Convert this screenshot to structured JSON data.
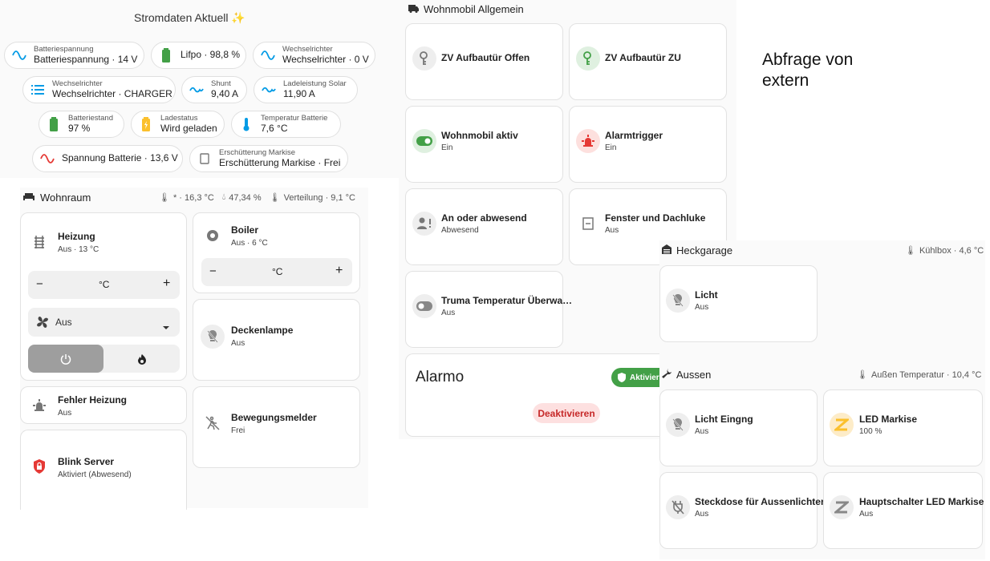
{
  "strom": {
    "title": "Stromdaten Aktuell",
    "sparkle": "✨",
    "chips": [
      {
        "small": "Batteriespannung",
        "big": "Batteriespannung · 14 V"
      },
      {
        "small": "",
        "big": "Lifpo · 98,8 %"
      },
      {
        "small": "Wechselrichter",
        "big": "Wechselrichter · 0 V"
      },
      {
        "small": "Wechselrichter",
        "big": "Wechselrichter · CHARGER"
      },
      {
        "small": "Shunt",
        "big": "9,40 A"
      },
      {
        "small": "Ladeleistung Solar",
        "big": "11,90 A"
      },
      {
        "small": "Batteriestand",
        "big": "97 %"
      },
      {
        "small": "Ladestatus",
        "big": "Wird geladen"
      },
      {
        "small": "Temperatur Batterie",
        "big": "7,6 °C"
      },
      {
        "small": "",
        "big": "Spannung Batterie · 13,6 V"
      },
      {
        "small": "Erschütterung Markise",
        "big": "Erschütterung Markise · Frei"
      }
    ]
  },
  "wohnraum": {
    "title": "Wohnraum",
    "meta1": "* · 16,3 °C",
    "meta2": "47,34 %",
    "meta3": "Verteilung · 9,1 °C",
    "heizung": {
      "title": "Heizung",
      "state": "Aus · 13 °C",
      "unit": "°C",
      "minus": "−",
      "plus": "+",
      "mode": "Aus"
    },
    "boiler": {
      "title": "Boiler",
      "state": "Aus · 6 °C",
      "unit": "°C",
      "minus": "−",
      "plus": "+"
    },
    "deckenlampe": {
      "title": "Deckenlampe",
      "state": "Aus"
    },
    "fehler": {
      "title": "Fehler Heizung",
      "state": "Aus"
    },
    "bewegung": {
      "title": "Bewegungsmelder",
      "state": "Frei"
    },
    "blink": {
      "title": "Blink Server",
      "state": "Aktiviert (Abwesend)"
    }
  },
  "wohnmobil": {
    "title": "Wohnmobil Allgemein",
    "tiles": [
      {
        "title": "ZV Aufbautür Offen",
        "state": ""
      },
      {
        "title": "ZV Aufbautür ZU",
        "state": ""
      },
      {
        "title": "Wohnmobil aktiv",
        "state": "Ein"
      },
      {
        "title": "Alarmtrigger",
        "state": "Ein"
      },
      {
        "title": "An oder abwesend",
        "state": "Abwesend"
      },
      {
        "title": "Fenster und Dachluke",
        "state": "Aus"
      },
      {
        "title": "Truma Temperatur Überwa…",
        "state": "Aus"
      }
    ],
    "alarmo": {
      "title": "Alarmo",
      "badge": "Aktivier",
      "button": "Deaktivieren"
    }
  },
  "extern": {
    "line1": "Abfrage von",
    "line2": "extern"
  },
  "heckgarage": {
    "title": "Heckgarage",
    "meta": "Kühlbox · 4,6 °C",
    "licht": {
      "title": "Licht",
      "state": "Aus"
    }
  },
  "aussen": {
    "title": "Aussen",
    "meta": "Außen Temperatur · 10,4 °C",
    "tiles": [
      {
        "title": "Licht Eingng",
        "state": "Aus"
      },
      {
        "title": "LED Markise",
        "state": "100 %"
      },
      {
        "title": "Steckdose für Aussenlichter",
        "state": "Aus"
      },
      {
        "title": "Hauptschalter LED Markise",
        "state": "Aus"
      }
    ]
  },
  "colors": {
    "green": "#43a047",
    "yellow": "#fbc02d",
    "blue": "#039be5",
    "red": "#e53935",
    "orange": "#ff9800"
  }
}
